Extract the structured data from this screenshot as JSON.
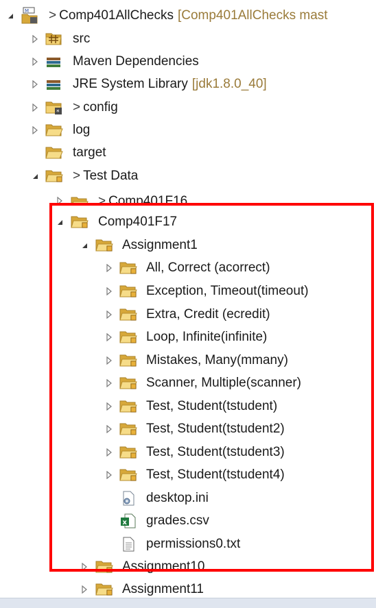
{
  "tree": {
    "project": {
      "prefix": ">",
      "label": "Comp401AllChecks",
      "decoration": "[Comp401AllChecks mast"
    },
    "src": {
      "label": "src"
    },
    "maven": {
      "label": "Maven Dependencies"
    },
    "jre": {
      "label": "JRE System Library",
      "decoration": "[jdk1.8.0_40]"
    },
    "config": {
      "prefix": ">",
      "label": "config"
    },
    "log": {
      "label": "log"
    },
    "target": {
      "label": "target"
    },
    "testdata": {
      "prefix": ">",
      "label": "Test Data"
    },
    "f16": {
      "prefix": ">",
      "label": "Comp401F16"
    },
    "f17": {
      "label": "Comp401F17"
    },
    "assignment1": {
      "label": "Assignment1"
    },
    "folders": [
      {
        "label": "All, Correct (acorrect)"
      },
      {
        "label": "Exception, Timeout(timeout)"
      },
      {
        "label": "Extra, Credit (ecredit)"
      },
      {
        "label": "Loop, Infinite(infinite)"
      },
      {
        "label": "Mistakes, Many(mmany)"
      },
      {
        "label": "Scanner, Multiple(scanner)"
      },
      {
        "label": "Test, Student(tstudent)"
      },
      {
        "label": "Test, Student(tstudent2)"
      },
      {
        "label": "Test, Student(tstudent3)"
      },
      {
        "label": "Test, Student(tstudent4)"
      }
    ],
    "files": [
      {
        "label": "desktop.ini",
        "icon": "ini-file-icon"
      },
      {
        "label": "grades.csv",
        "icon": "excel-file-icon"
      },
      {
        "label": "permissions0.txt",
        "icon": "text-file-icon"
      }
    ],
    "assignment10": {
      "label": "Assignment10"
    },
    "assignment11": {
      "label": "Assignment11"
    }
  },
  "colors": {
    "highlight": "#ff0000",
    "decoration": "#9a7b3a",
    "folder": "#e9c25a"
  }
}
